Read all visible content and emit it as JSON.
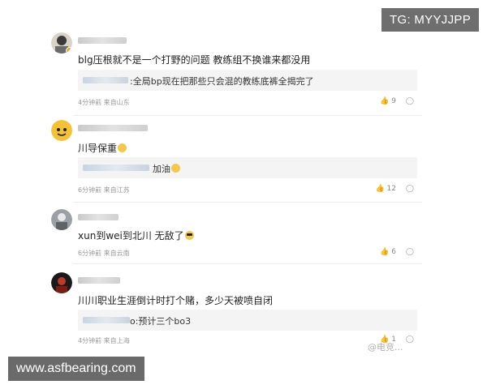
{
  "overlays": {
    "top_right": "TG: MYYJJPP",
    "bottom_left": "www.asfbearing.com"
  },
  "watermark": "@电竞...",
  "comments": [
    {
      "name_start": "",
      "text": "blg压根就不是一个打野的问题 教练组不换谁来都没用",
      "reply_text": ":全局bp现在把那些只会混的教练底裤全揭完了",
      "meta": "4分钟前 来自山东",
      "likes": "9",
      "reply_icon": "reply-icon"
    },
    {
      "name_start": "",
      "text": "川导保重",
      "reply_text": "加油",
      "meta": "6分钟前 来自江苏",
      "likes": "12",
      "reply_icon": "reply-icon"
    },
    {
      "name_start": "",
      "text": "xun到wei到北川 无敌了",
      "reply_text": "",
      "meta": "6分钟前 来自云南",
      "likes": "6",
      "reply_icon": "reply-icon"
    },
    {
      "name_start": "",
      "text": "川川职业生涯倒计时打个赌，多少天被喷自闭",
      "reply_text": "o:预计三个bo3",
      "meta": "4分钟前 来自上海",
      "likes": "1",
      "reply_icon": "reply-icon"
    }
  ],
  "colors": {
    "reply_bg": "#f4f4f4",
    "meta_text": "#999999",
    "overlay_bg": "#6e6e6e"
  }
}
